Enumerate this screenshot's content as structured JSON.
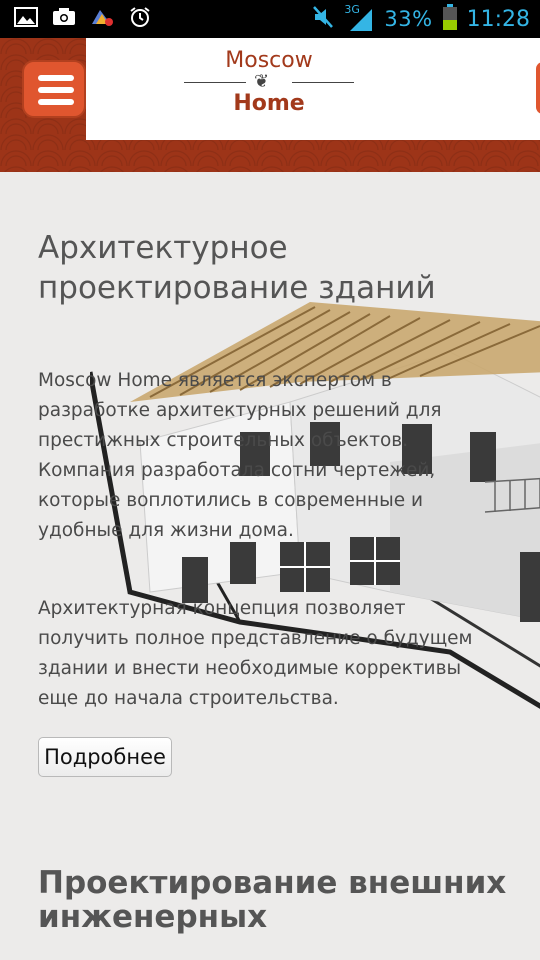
{
  "status_bar": {
    "signal_type": "3G",
    "battery_percent": "33%",
    "time": "11:28",
    "icons": [
      "image-icon",
      "camera-icon",
      "app-notification-icon",
      "alarm-icon",
      "mute-icon",
      "signal-icon",
      "battery-icon"
    ]
  },
  "header": {
    "logo_top": "Moscow",
    "logo_bottom": "Home",
    "menu_icon": "hamburger-menu-icon"
  },
  "section1": {
    "title": "Архитектурное проектирование зданий",
    "paragraph1": "Moscow Home является экспертом в разработке архитектурных решений для престижных строительных объектов. Компания разработала сотни чертежей, которые воплотились в современные и удобные для жизни дома.",
    "paragraph2": "Архитектурная концепция позволяет получить полное представление о будущем здании и внести необходимые коррективы еще до начала строительства.",
    "button_label": "Подробнее"
  },
  "section2": {
    "title": "Проектирование внешних инженерных"
  },
  "colors": {
    "brand_red": "#9d3418",
    "menu_orange": "#e0562f",
    "status_blue": "#34b5e5"
  }
}
